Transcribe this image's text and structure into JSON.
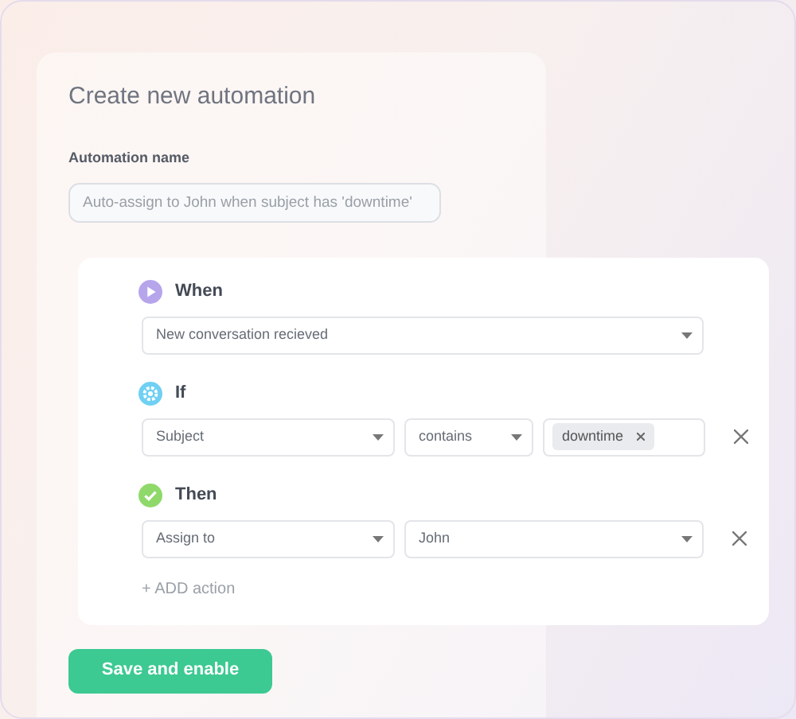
{
  "title": "Create new automation",
  "name_field": {
    "label": "Automation name",
    "placeholder": "Auto-assign to John when subject has 'downtime'"
  },
  "sections": [
    {
      "kind": "when",
      "title": "When",
      "rows": [
        {
          "fields": [
            {
              "kind": "select",
              "value": "New conversation recieved"
            }
          ],
          "removable": false
        }
      ]
    },
    {
      "kind": "if",
      "title": "If",
      "rows": [
        {
          "fields": [
            {
              "kind": "select",
              "value": "Subject"
            },
            {
              "kind": "select",
              "value": "contains"
            },
            {
              "kind": "tags",
              "tags": [
                "downtime"
              ]
            }
          ],
          "removable": true
        }
      ]
    },
    {
      "kind": "then",
      "title": "Then",
      "rows": [
        {
          "fields": [
            {
              "kind": "select",
              "value": "Assign to"
            },
            {
              "kind": "select",
              "value": "John"
            }
          ],
          "removable": true
        }
      ]
    }
  ],
  "add_action": "+ ADD action",
  "save_button": "Save and enable"
}
